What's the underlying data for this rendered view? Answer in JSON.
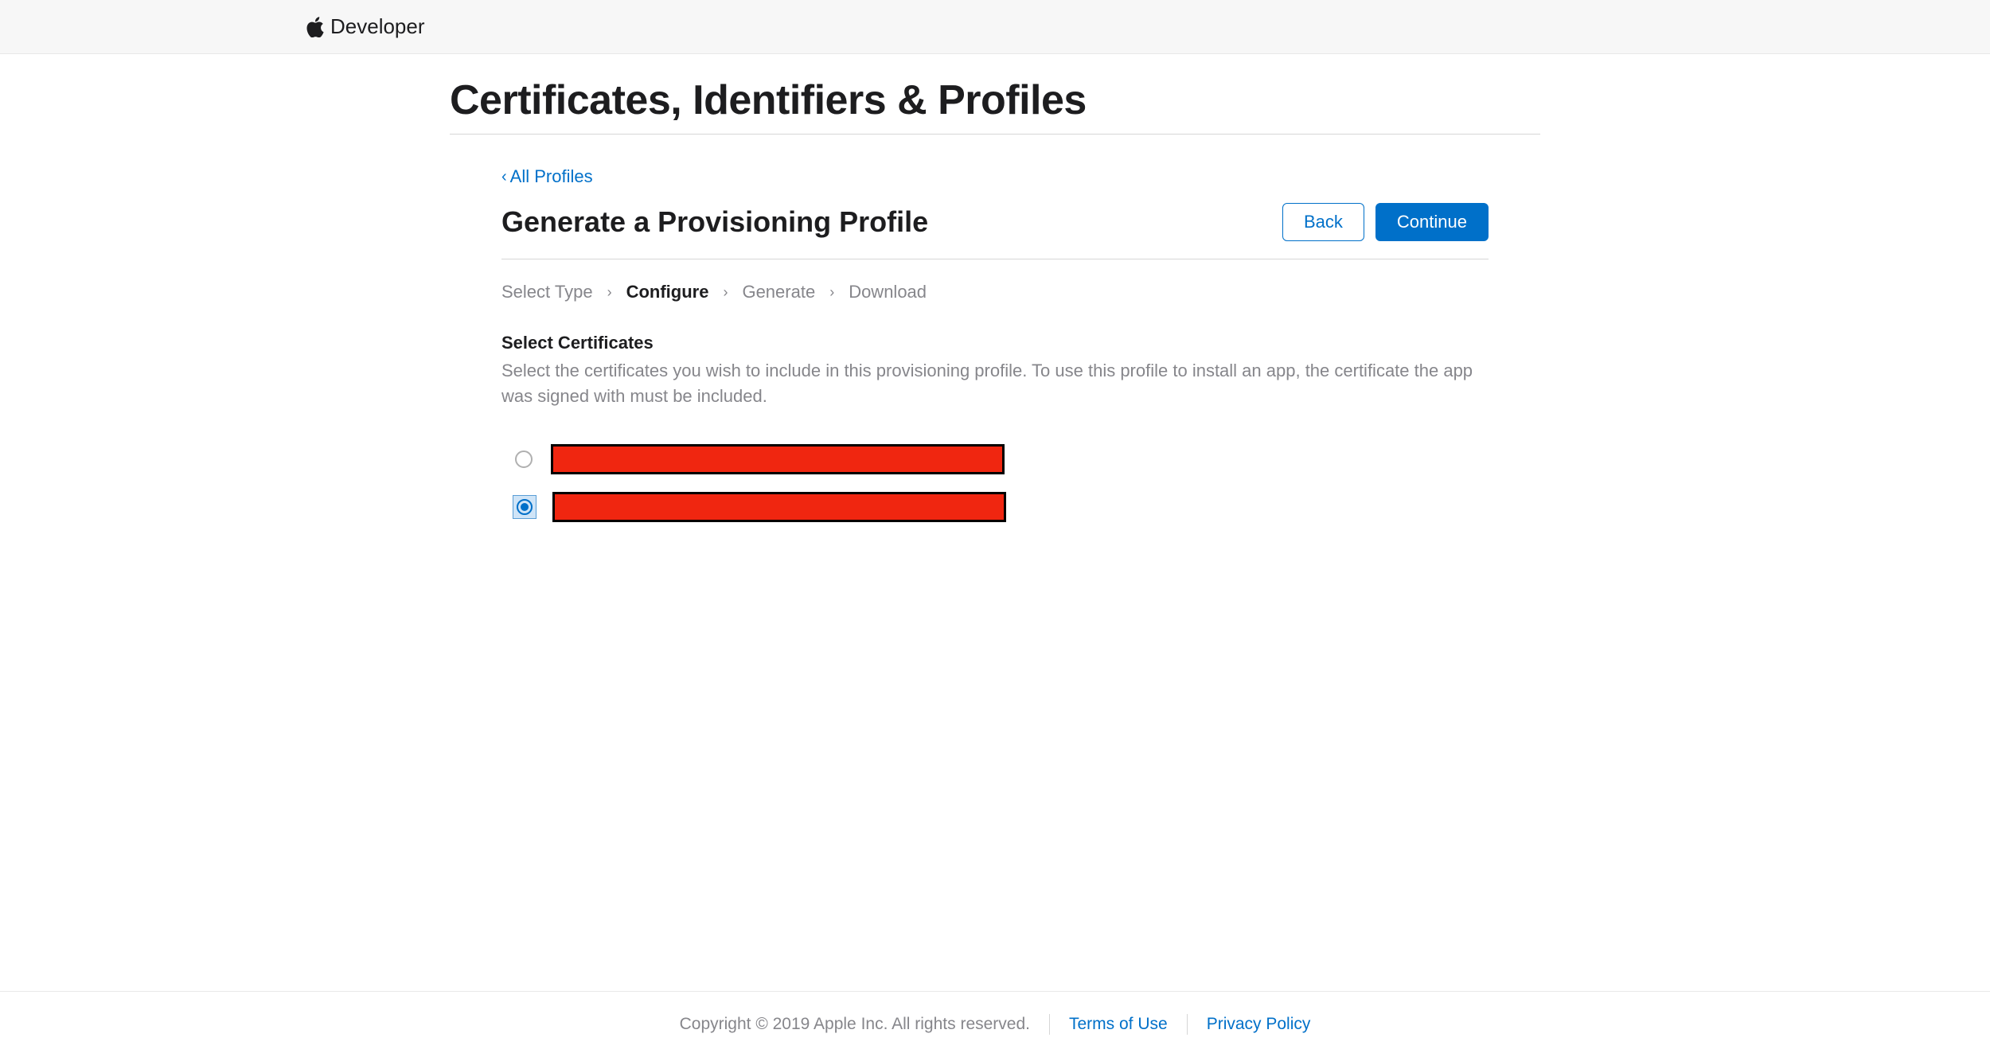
{
  "header": {
    "brand": "Developer"
  },
  "page": {
    "title": "Certificates, Identifiers & Profiles",
    "breadcrumb_back": "All Profiles",
    "sub_title": "Generate a Provisioning Profile",
    "back_button": "Back",
    "continue_button": "Continue"
  },
  "wizard": {
    "steps": [
      "Select Type",
      "Configure",
      "Generate",
      "Download"
    ],
    "active_index": 1
  },
  "section": {
    "heading": "Select Certificates",
    "description": "Select the certificates you wish to include in this provisioning profile. To use this profile to install an app, the certificate the app was signed with must be included."
  },
  "certificates": [
    {
      "label": "[redacted]",
      "selected": false
    },
    {
      "label": "[redacted]",
      "selected": true
    }
  ],
  "footer": {
    "copyright": "Copyright © 2019 Apple Inc. All rights reserved.",
    "terms": "Terms of Use",
    "privacy": "Privacy Policy"
  }
}
